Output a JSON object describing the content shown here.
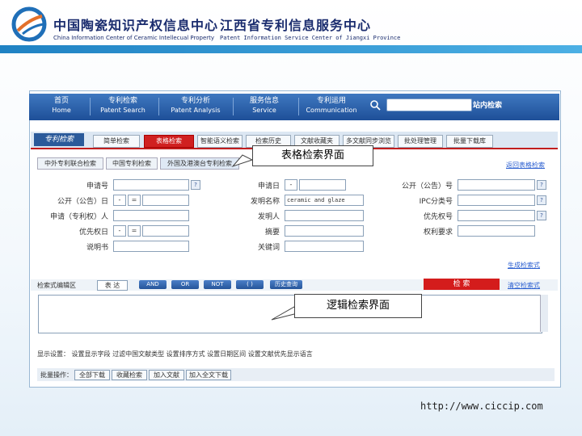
{
  "header": {
    "title_cn_1": "中国陶瓷知识产权信息中心",
    "title_en_1": "China Information Center of Ceramic Intellecual Property",
    "title_cn_2": "江西省专利信息服务中心",
    "title_en_2": "Patent Information Service Center of Jiangxi Province",
    "brand_color": "#1a2c6e",
    "band_color": "#1f82c3"
  },
  "nav": {
    "items": [
      {
        "cn": "首页",
        "en": "Home"
      },
      {
        "cn": "专利检索",
        "en": "Patent Search"
      },
      {
        "cn": "专利分析",
        "en": "Patent Analysis"
      },
      {
        "cn": "服务信息",
        "en": "Service"
      },
      {
        "cn": "专利运用",
        "en": "Communication"
      }
    ],
    "search_placeholder": "",
    "search_button": "站内检索"
  },
  "tabs": {
    "logo": "专利检索",
    "items": [
      "简单检索",
      "表格检索",
      "智能语义检索",
      "检索历史",
      "文献收藏夹",
      "多文献同步浏览",
      "批处理管理",
      "批量下载库"
    ],
    "active_index": 1,
    "active_color": "#d02020"
  },
  "subtabs": {
    "items": [
      "中外专利联合检索",
      "中国专利检索",
      "外国及港澳台专利检索"
    ],
    "active_index": 2,
    "help_link": "返回表格检索"
  },
  "form": {
    "left": [
      {
        "label": "申请号"
      },
      {
        "label": "公开（公告）日"
      },
      {
        "label": "申请（专利权）人"
      },
      {
        "label": "优先权日"
      },
      {
        "label": "说明书"
      }
    ],
    "middle": [
      {
        "label": "申请日",
        "value": ""
      },
      {
        "label": "发明名称",
        "value": "ceramic and glaze"
      },
      {
        "label": "发明人",
        "value": ""
      },
      {
        "label": "摘要",
        "value": ""
      },
      {
        "label": "关键词",
        "value": ""
      }
    ],
    "right": [
      {
        "label": "公开（公告）号"
      },
      {
        "label": "IPC分类号"
      },
      {
        "label": "优先权号"
      },
      {
        "label": "权利要求"
      }
    ],
    "select_value": "=",
    "select_dash": "-",
    "help_glyph": "?",
    "generate_link": "生成检索式"
  },
  "logic": {
    "label": "检索式编辑区",
    "mode_value": "表 达",
    "buttons": [
      "AND",
      "OR",
      "NOT",
      "( )"
    ],
    "history_button": "历史查询",
    "search_button": "检 索",
    "clear_link": "清空检索式"
  },
  "display": {
    "text": "显示设置：  设置显示字段   过滤中国文献类型   设置排序方式   设置日期区间   设置文献优先显示语言"
  },
  "ops": {
    "label": "批量操作：",
    "buttons": [
      "全部下载",
      "收藏检索",
      "加入文献",
      "加入全文下载"
    ]
  },
  "callouts": {
    "table_search": "表格检索界面",
    "logic_search": "逻辑检索界面"
  },
  "footer": {
    "url": "http://www.ciccip.com"
  }
}
